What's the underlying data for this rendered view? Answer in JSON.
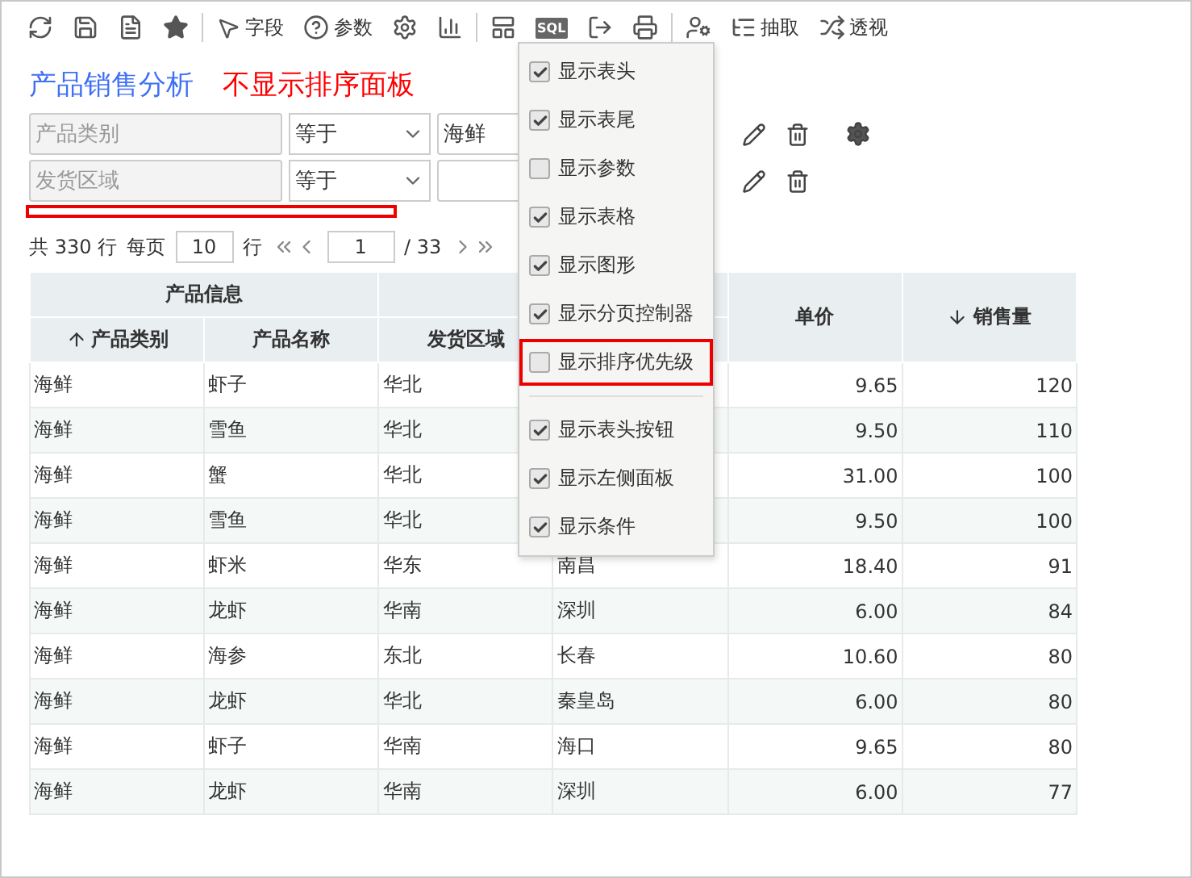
{
  "toolbar": {
    "labels": [
      "字段",
      "参数",
      "SQL",
      "抽取",
      "透视"
    ]
  },
  "report": {
    "title": "产品销售分析",
    "annotation": "不显示排序面板"
  },
  "filters": [
    {
      "field_placeholder": "产品类别",
      "operator": "等于",
      "value": "海鲜",
      "settings": true
    },
    {
      "field_placeholder": "发货区域",
      "operator": "等于",
      "settings": false
    }
  ],
  "pagination": {
    "total": "共 330 行",
    "per_page_label": "每页",
    "per_page": "10",
    "rows_label": "行",
    "page": "1",
    "pages": "/ 33"
  },
  "table": {
    "header": [
      {
        "group": "产品信息",
        "columns": [
          {
            "label": "产品类别",
            "sort_up": true,
            "sort_down": false
          },
          {
            "label": "产品名称",
            "sort_up": false,
            "sort_down": false
          }
        ]
      },
      {
        "columns": [
          {
            "label": "发货区域",
            "sort_up": false,
            "sort_down": false
          }
        ]
      },
      {
        "label": "单价",
        "sort_up": false,
        "sort_down": false
      },
      {
        "label": "销售量",
        "sort_up": false,
        "sort_down": true
      }
    ],
    "rows": [
      [
        "海鲜",
        "虾子",
        "华北",
        null,
        "9.65",
        "120"
      ],
      [
        "海鲜",
        "雪鱼",
        "华北",
        null,
        "9.50",
        "110"
      ],
      [
        "海鲜",
        "蟹",
        "华北",
        null,
        "31.00",
        "100"
      ],
      [
        "海鲜",
        "雪鱼",
        "华北",
        null,
        "9.50",
        "100"
      ],
      [
        "海鲜",
        "虾米",
        "华东",
        "南昌",
        "18.40",
        "91"
      ],
      [
        "海鲜",
        "龙虾",
        "华南",
        "深圳",
        "6.00",
        "84"
      ],
      [
        "海鲜",
        "海参",
        "东北",
        "长春",
        "10.60",
        "80"
      ],
      [
        "海鲜",
        "龙虾",
        "华北",
        "秦皇岛",
        "6.00",
        "80"
      ],
      [
        "海鲜",
        "虾子",
        "华南",
        "海口",
        "9.65",
        "80"
      ],
      [
        "海鲜",
        "龙虾",
        "华南",
        "深圳",
        "6.00",
        "77"
      ]
    ]
  },
  "menu": {
    "groups": [
      [
        {
          "label": "显示表头",
          "checked": true,
          "outlined": false
        },
        {
          "label": "显示表尾",
          "checked": true,
          "outlined": false
        },
        {
          "label": "显示参数",
          "checked": false,
          "outlined": false
        },
        {
          "label": "显示表格",
          "checked": true,
          "outlined": false
        },
        {
          "label": "显示图形",
          "checked": true,
          "outlined": false
        },
        {
          "label": "显示分页控制器",
          "checked": true,
          "outlined": false
        },
        {
          "label": "显示排序优先级",
          "checked": false,
          "outlined": true
        }
      ],
      [
        {
          "label": "显示表头按钮",
          "checked": true,
          "outlined": false
        },
        {
          "label": "显示左侧面板",
          "checked": true,
          "outlined": false
        },
        {
          "label": "显示条件",
          "checked": true,
          "outlined": false
        }
      ]
    ]
  }
}
